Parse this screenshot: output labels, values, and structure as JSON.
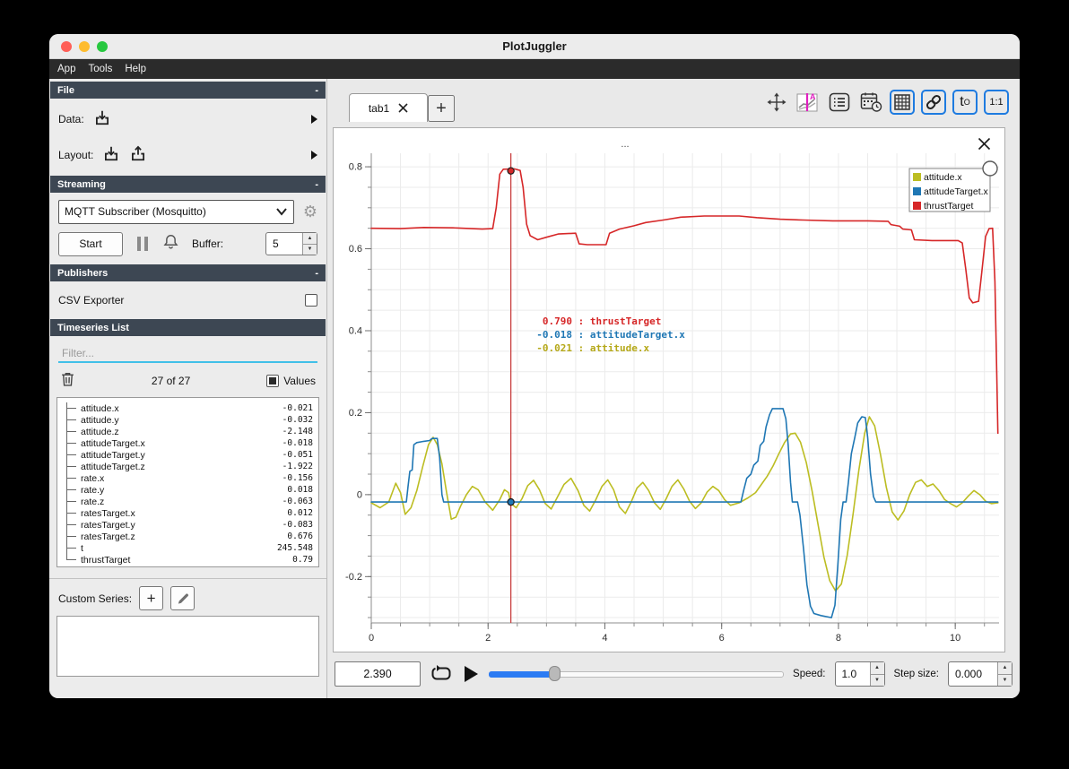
{
  "window": {
    "title": "PlotJuggler"
  },
  "menu": {
    "items": [
      "App",
      "Tools",
      "Help"
    ]
  },
  "sidebar": {
    "file": {
      "header": "File",
      "collapse": "-",
      "data_label": "Data:",
      "layout_label": "Layout:"
    },
    "streaming": {
      "header": "Streaming",
      "collapse": "-",
      "source": "MQTT Subscriber (Mosquitto)",
      "start_label": "Start",
      "buffer_label": "Buffer:",
      "buffer_value": "5"
    },
    "publishers": {
      "header": "Publishers",
      "collapse": "-",
      "csv_label": "CSV Exporter"
    },
    "timeseries": {
      "header": "Timeseries List",
      "collapse": "-",
      "filter_placeholder": "Filter...",
      "count": "27 of 27",
      "values_label": "Values",
      "items": [
        {
          "name": "attitude.x",
          "value": "-0.021"
        },
        {
          "name": "attitude.y",
          "value": "-0.032"
        },
        {
          "name": "attitude.z",
          "value": "-2.148"
        },
        {
          "name": "attitudeTarget.x",
          "value": "-0.018"
        },
        {
          "name": "attitudeTarget.y",
          "value": "-0.051"
        },
        {
          "name": "attitudeTarget.z",
          "value": "-1.922"
        },
        {
          "name": "rate.x",
          "value": "-0.156"
        },
        {
          "name": "rate.y",
          "value": "0.018"
        },
        {
          "name": "rate.z",
          "value": "-0.063"
        },
        {
          "name": "ratesTarget.x",
          "value": "0.012"
        },
        {
          "name": "ratesTarget.y",
          "value": "-0.083"
        },
        {
          "name": "ratesTarget.z",
          "value": "0.676"
        },
        {
          "name": "t",
          "value": "245.548"
        },
        {
          "name": "thrustTarget",
          "value": "0.79"
        }
      ]
    },
    "custom": {
      "label": "Custom Series:"
    }
  },
  "tabs": {
    "active": "tab1",
    "add_label": "+"
  },
  "toolbar": {
    "t0_main": "t",
    "t0_sub": "O",
    "ratio_label": "1:1"
  },
  "plot": {
    "title": "...",
    "tracker": {
      "x": 2.39,
      "lines": [
        {
          "value": "0.790",
          "sep": " : ",
          "label": "thrustTarget",
          "color": "#d62728"
        },
        {
          "value": "-0.018",
          "sep": " : ",
          "label": "attitudeTarget.x",
          "color": "#1f77b4"
        },
        {
          "value": "-0.021",
          "sep": " : ",
          "label": "attitude.x",
          "color": "#b5a818"
        }
      ],
      "markers": [
        {
          "x": 2.39,
          "y": 0.79,
          "color": "#d62728"
        },
        {
          "x": 2.39,
          "y": -0.018,
          "color": "#1f77b4"
        }
      ]
    }
  },
  "chart_data": {
    "type": "line",
    "x_range": [
      0,
      10.75
    ],
    "y_range": [
      -0.313,
      0.833
    ],
    "x_ticks": [
      0,
      2,
      4,
      6,
      8,
      10
    ],
    "y_ticks": [
      0.8,
      0.6,
      0.4,
      0.2,
      0,
      -0.2
    ],
    "x_minor_step": 0.5,
    "y_minor_step": 0.05,
    "grid": true,
    "legend_position": "top-right",
    "series": [
      {
        "name": "attitude.x",
        "color": "#bcbd22",
        "points": [
          [
            0,
            -0.02
          ],
          [
            0.15,
            -0.032
          ],
          [
            0.3,
            -0.018
          ],
          [
            0.42,
            0.028
          ],
          [
            0.5,
            0.005
          ],
          [
            0.58,
            -0.048
          ],
          [
            0.68,
            -0.032
          ],
          [
            0.78,
            0.01
          ],
          [
            0.88,
            0.068
          ],
          [
            0.98,
            0.122
          ],
          [
            1.06,
            0.14
          ],
          [
            1.13,
            0.122
          ],
          [
            1.21,
            0.075
          ],
          [
            1.29,
            0.005
          ],
          [
            1.37,
            -0.06
          ],
          [
            1.45,
            -0.055
          ],
          [
            1.53,
            -0.028
          ],
          [
            1.63,
            0
          ],
          [
            1.73,
            0.02
          ],
          [
            1.83,
            0.012
          ],
          [
            1.95,
            -0.018
          ],
          [
            2.08,
            -0.038
          ],
          [
            2.2,
            -0.012
          ],
          [
            2.28,
            0.012
          ],
          [
            2.35,
            0.005
          ],
          [
            2.39,
            -0.021
          ],
          [
            2.48,
            -0.032
          ],
          [
            2.58,
            -0.01
          ],
          [
            2.68,
            0.022
          ],
          [
            2.78,
            0.035
          ],
          [
            2.88,
            0.012
          ],
          [
            2.98,
            -0.022
          ],
          [
            3.08,
            -0.035
          ],
          [
            3.18,
            -0.008
          ],
          [
            3.3,
            0.025
          ],
          [
            3.42,
            0.04
          ],
          [
            3.54,
            0.01
          ],
          [
            3.64,
            -0.026
          ],
          [
            3.74,
            -0.04
          ],
          [
            3.84,
            -0.014
          ],
          [
            3.95,
            0.02
          ],
          [
            4.05,
            0.036
          ],
          [
            4.15,
            0.012
          ],
          [
            4.25,
            -0.03
          ],
          [
            4.35,
            -0.046
          ],
          [
            4.45,
            -0.018
          ],
          [
            4.55,
            0.016
          ],
          [
            4.65,
            0.03
          ],
          [
            4.75,
            0.01
          ],
          [
            4.85,
            -0.02
          ],
          [
            4.95,
            -0.036
          ],
          [
            5.05,
            -0.01
          ],
          [
            5.15,
            0.02
          ],
          [
            5.25,
            0.036
          ],
          [
            5.35,
            0.014
          ],
          [
            5.45,
            -0.016
          ],
          [
            5.55,
            -0.034
          ],
          [
            5.65,
            -0.02
          ],
          [
            5.75,
            0.006
          ],
          [
            5.85,
            0.02
          ],
          [
            5.95,
            0.01
          ],
          [
            6.05,
            -0.012
          ],
          [
            6.15,
            -0.026
          ],
          [
            6.3,
            -0.02
          ],
          [
            6.45,
            -0.008
          ],
          [
            6.58,
            0.005
          ],
          [
            6.68,
            0.025
          ],
          [
            6.78,
            0.045
          ],
          [
            6.88,
            0.07
          ],
          [
            6.98,
            0.1
          ],
          [
            7.08,
            0.128
          ],
          [
            7.18,
            0.148
          ],
          [
            7.26,
            0.15
          ],
          [
            7.35,
            0.128
          ],
          [
            7.45,
            0.078
          ],
          [
            7.55,
            0.008
          ],
          [
            7.65,
            -0.072
          ],
          [
            7.75,
            -0.152
          ],
          [
            7.85,
            -0.21
          ],
          [
            7.95,
            -0.235
          ],
          [
            8.05,
            -0.218
          ],
          [
            8.15,
            -0.148
          ],
          [
            8.25,
            -0.048
          ],
          [
            8.35,
            0.06
          ],
          [
            8.45,
            0.15
          ],
          [
            8.53,
            0.19
          ],
          [
            8.62,
            0.168
          ],
          [
            8.72,
            0.098
          ],
          [
            8.82,
            0.018
          ],
          [
            8.92,
            -0.042
          ],
          [
            9.02,
            -0.062
          ],
          [
            9.12,
            -0.04
          ],
          [
            9.22,
            0
          ],
          [
            9.32,
            0.03
          ],
          [
            9.42,
            0.036
          ],
          [
            9.52,
            0.02
          ],
          [
            9.62,
            0.026
          ],
          [
            9.72,
            0.01
          ],
          [
            9.82,
            -0.012
          ],
          [
            9.92,
            -0.022
          ],
          [
            10.02,
            -0.03
          ],
          [
            10.12,
            -0.02
          ],
          [
            10.22,
            -0.004
          ],
          [
            10.32,
            0.01
          ],
          [
            10.42,
            0
          ],
          [
            10.52,
            -0.016
          ],
          [
            10.62,
            -0.022
          ],
          [
            10.73,
            -0.02
          ]
        ]
      },
      {
        "name": "attitudeTarget.x",
        "color": "#1f77b4",
        "points": [
          [
            0,
            -0.018
          ],
          [
            0.6,
            -0.018
          ],
          [
            0.63,
            0.02
          ],
          [
            0.66,
            0.057
          ],
          [
            0.7,
            0.06
          ],
          [
            0.73,
            0.122
          ],
          [
            0.78,
            0.127
          ],
          [
            0.9,
            0.13
          ],
          [
            1,
            0.132
          ],
          [
            1.04,
            0.137
          ],
          [
            1.13,
            0.137
          ],
          [
            1.17,
            0.09
          ],
          [
            1.21,
            0
          ],
          [
            1.24,
            -0.018
          ],
          [
            6.33,
            -0.018
          ],
          [
            6.38,
            0.012
          ],
          [
            6.43,
            0.04
          ],
          [
            6.5,
            0.05
          ],
          [
            6.55,
            0.072
          ],
          [
            6.62,
            0.082
          ],
          [
            6.66,
            0.12
          ],
          [
            6.72,
            0.13
          ],
          [
            6.76,
            0.165
          ],
          [
            6.82,
            0.195
          ],
          [
            6.87,
            0.21
          ],
          [
            7.05,
            0.21
          ],
          [
            7.1,
            0.185
          ],
          [
            7.14,
            0.12
          ],
          [
            7.18,
            0.03
          ],
          [
            7.21,
            -0.018
          ],
          [
            7.3,
            -0.018
          ],
          [
            7.34,
            -0.05
          ],
          [
            7.4,
            -0.13
          ],
          [
            7.46,
            -0.22
          ],
          [
            7.52,
            -0.272
          ],
          [
            7.58,
            -0.29
          ],
          [
            7.7,
            -0.295
          ],
          [
            7.88,
            -0.3
          ],
          [
            7.94,
            -0.27
          ],
          [
            7.99,
            -0.17
          ],
          [
            8.04,
            -0.06
          ],
          [
            8.08,
            -0.018
          ],
          [
            8.13,
            -0.018
          ],
          [
            8.17,
            0.03
          ],
          [
            8.22,
            0.1
          ],
          [
            8.28,
            0.14
          ],
          [
            8.33,
            0.175
          ],
          [
            8.4,
            0.19
          ],
          [
            8.46,
            0.188
          ],
          [
            8.5,
            0.14
          ],
          [
            8.55,
            0.05
          ],
          [
            8.6,
            -0.005
          ],
          [
            8.64,
            -0.018
          ],
          [
            10.73,
            -0.018
          ]
        ]
      },
      {
        "name": "thrustTarget",
        "color": "#d62728",
        "points": [
          [
            0,
            0.65
          ],
          [
            0.5,
            0.649
          ],
          [
            0.9,
            0.652
          ],
          [
            1.4,
            0.651
          ],
          [
            1.9,
            0.648
          ],
          [
            2.08,
            0.649
          ],
          [
            2.14,
            0.7
          ],
          [
            2.2,
            0.782
          ],
          [
            2.26,
            0.794
          ],
          [
            2.45,
            0.795
          ],
          [
            2.55,
            0.791
          ],
          [
            2.6,
            0.75
          ],
          [
            2.66,
            0.66
          ],
          [
            2.72,
            0.632
          ],
          [
            2.85,
            0.622
          ],
          [
            3,
            0.628
          ],
          [
            3.2,
            0.636
          ],
          [
            3.5,
            0.638
          ],
          [
            3.56,
            0.612
          ],
          [
            3.7,
            0.61
          ],
          [
            4.02,
            0.61
          ],
          [
            4.08,
            0.638
          ],
          [
            4.25,
            0.648
          ],
          [
            4.5,
            0.656
          ],
          [
            4.7,
            0.664
          ],
          [
            5,
            0.67
          ],
          [
            5.3,
            0.677
          ],
          [
            5.7,
            0.68
          ],
          [
            6.3,
            0.68
          ],
          [
            6.6,
            0.676
          ],
          [
            7,
            0.672
          ],
          [
            7.4,
            0.67
          ],
          [
            7.9,
            0.668
          ],
          [
            8.5,
            0.668
          ],
          [
            8.85,
            0.667
          ],
          [
            8.9,
            0.659
          ],
          [
            9.05,
            0.655
          ],
          [
            9.1,
            0.648
          ],
          [
            9.25,
            0.646
          ],
          [
            9.3,
            0.622
          ],
          [
            9.6,
            0.62
          ],
          [
            10.05,
            0.62
          ],
          [
            10.12,
            0.614
          ],
          [
            10.18,
            0.55
          ],
          [
            10.24,
            0.48
          ],
          [
            10.3,
            0.468
          ],
          [
            10.4,
            0.472
          ],
          [
            10.46,
            0.55
          ],
          [
            10.52,
            0.63
          ],
          [
            10.58,
            0.649
          ],
          [
            10.64,
            0.65
          ],
          [
            10.68,
            0.52
          ],
          [
            10.71,
            0.3
          ],
          [
            10.73,
            0.15
          ]
        ]
      }
    ]
  },
  "transport": {
    "time": "2.390",
    "slider_fraction": 0.222,
    "speed_label": "Speed:",
    "speed_value": "1.0",
    "step_label": "Step size:",
    "step_value": "0.000"
  }
}
